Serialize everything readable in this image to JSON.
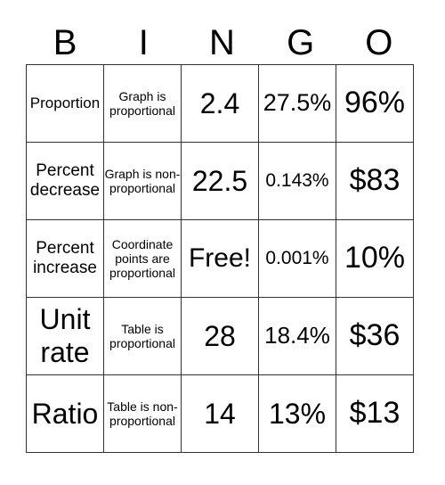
{
  "header": [
    "B",
    "I",
    "N",
    "G",
    "O"
  ],
  "cells": [
    [
      "Proportion",
      "Graph is proportional",
      "2.4",
      "27.5%",
      "96%"
    ],
    [
      "Percent decrease",
      "Graph is non-proportional",
      "22.5",
      "0.143%",
      "$83"
    ],
    [
      "Percent increase",
      "Coordinate points are proportional",
      "Free!",
      "0.001%",
      "10%"
    ],
    [
      "Unit rate",
      "Table is proportional",
      "28",
      "18.4%",
      "$36"
    ],
    [
      "Ratio",
      "Table is non-proportional",
      "14",
      "13%",
      "$13"
    ]
  ]
}
